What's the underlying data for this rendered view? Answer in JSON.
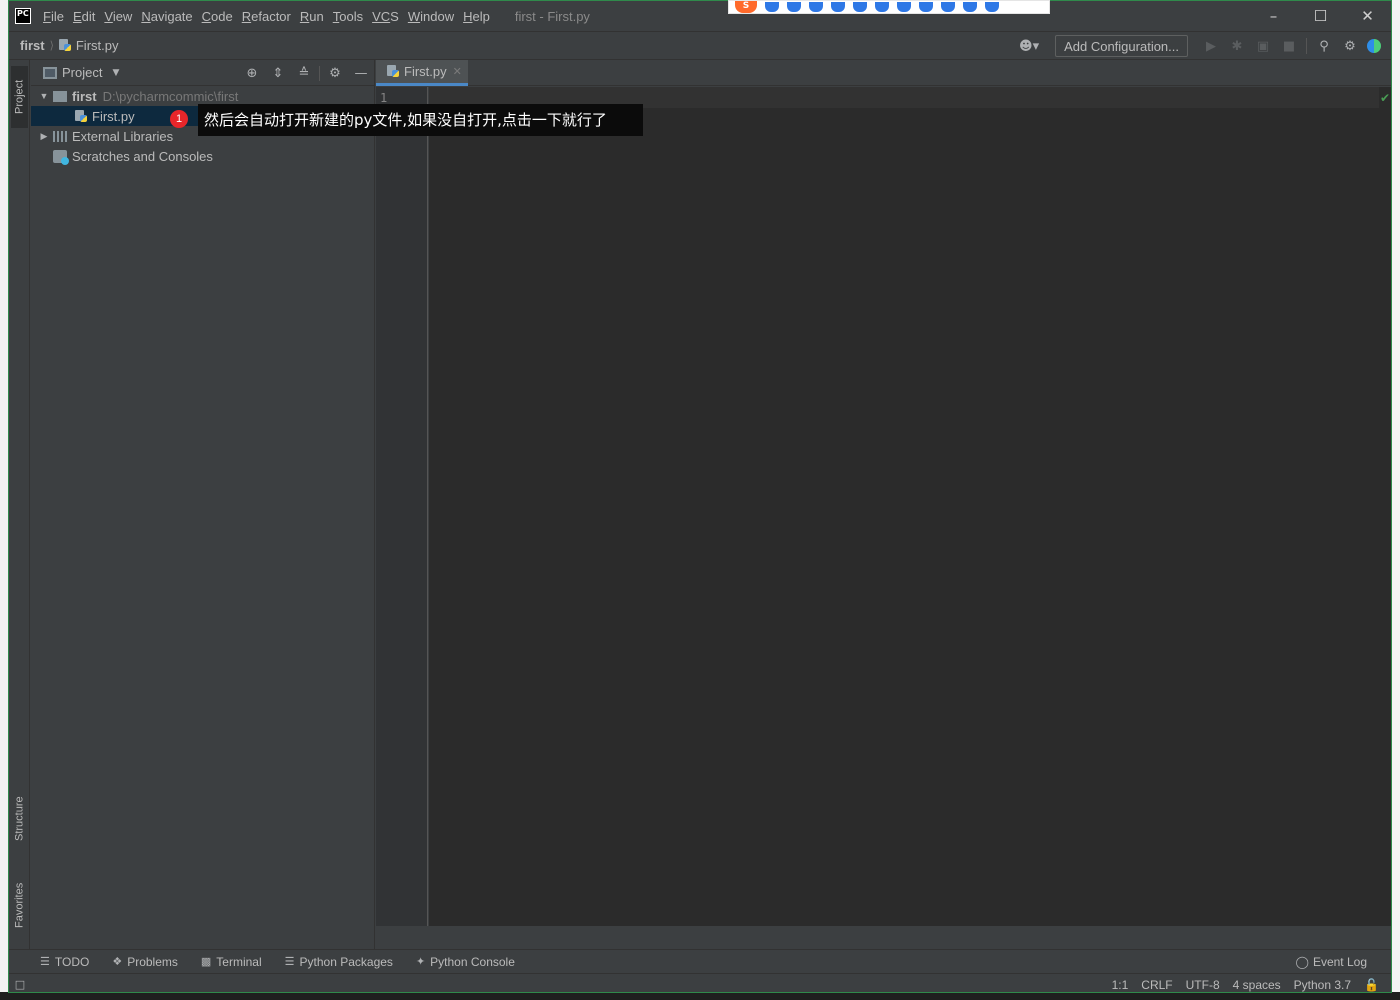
{
  "menubar": {
    "logo": "PC",
    "items": [
      {
        "mn": "F",
        "rest": "ile"
      },
      {
        "mn": "E",
        "rest": "dit"
      },
      {
        "mn": "V",
        "rest": "iew"
      },
      {
        "mn": "N",
        "rest": "avigate"
      },
      {
        "mn": "C",
        "rest": "ode"
      },
      {
        "mn": "R",
        "rest": "efactor"
      },
      {
        "mn": "R",
        "rest": "un"
      },
      {
        "mn": "T",
        "rest": "ools"
      },
      {
        "mn": "VC",
        "rest": "S"
      },
      {
        "mn": "W",
        "rest": "indow"
      },
      {
        "mn": "H",
        "rest": "elp"
      }
    ],
    "window_title": "first - First.py"
  },
  "navbar": {
    "project": "first",
    "file": "First.py",
    "add_configuration": "Add Configuration..."
  },
  "left_stripe": {
    "project_tab": "Project",
    "structure_tab": "Structure",
    "favorites_tab": "Favorites"
  },
  "project_panel": {
    "title": "Project",
    "tree": {
      "root_name": "first",
      "root_path": "D:\\pycharmcommic\\first",
      "file": "First.py",
      "external_libraries": "External Libraries",
      "scratches": "Scratches and Consoles"
    }
  },
  "tutorial": {
    "step": "1",
    "text": "然后会自动打开新建的py文件,如果没自打开,点击一下就行了"
  },
  "editor": {
    "tab_label": "First.py",
    "line_number": "1"
  },
  "bottom_tools": {
    "todo": "TODO",
    "problems": "Problems",
    "terminal": "Terminal",
    "python_packages": "Python Packages",
    "python_console": "Python Console",
    "event_log": "Event Log"
  },
  "status": {
    "position": "1:1",
    "line_sep": "CRLF",
    "encoding": "UTF-8",
    "indent": "4 spaces",
    "interpreter": "Python 3.7"
  },
  "colors": {
    "accent": "#4a88c7",
    "editor_bg": "#2b2b2b",
    "panel_bg": "#3c3f41",
    "tutorial_badge": "#e8262a"
  },
  "icons": {
    "user": "user-icon",
    "run": "run-icon",
    "debug": "debug-icon",
    "coverage": "coverage-icon",
    "stop": "stop-icon",
    "search": "search-icon",
    "settings": "gear-icon",
    "code_with_me": "code-with-me-icon"
  }
}
